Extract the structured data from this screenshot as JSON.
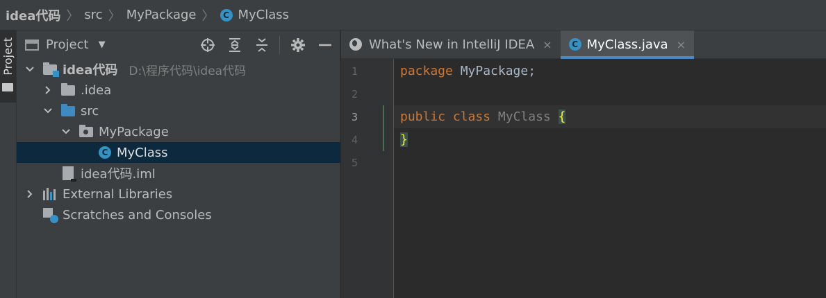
{
  "breadcrumb": {
    "project": "idea代码",
    "src": "src",
    "package": "MyPackage",
    "class": "MyClass",
    "class_icon": "C"
  },
  "toolstrip": {
    "project_label": "Project"
  },
  "project_panel": {
    "title": "Project",
    "tree": {
      "root": {
        "name": "idea代码",
        "path": "D:\\程序代码\\idea代码"
      },
      "idea_folder": ".idea",
      "src_folder": "src",
      "package": "MyPackage",
      "class": "MyClass",
      "class_icon": "C",
      "iml_file": "idea代码.iml",
      "external_libraries": "External Libraries",
      "scratches": "Scratches and Consoles"
    }
  },
  "editor": {
    "tabs": [
      {
        "label": "What's New in IntelliJ IDEA",
        "icon": "globe-icon",
        "close": "×"
      },
      {
        "label": "MyClass.java",
        "icon": "class-icon",
        "icon_letter": "C",
        "close": "×",
        "active": true
      }
    ],
    "line_numbers": [
      "1",
      "2",
      "3",
      "4",
      "5"
    ],
    "code": {
      "line1_kw": "package",
      "line1_rest": " MyPackage;",
      "line3_kw1": "public",
      "line3_kw2": "class",
      "line3_name": "MyClass",
      "line3_brace": "{",
      "line4_brace": "}"
    }
  },
  "colors": {
    "keyword": "#cc7832",
    "identifier": "#a9b7c6",
    "class_name": "#808080",
    "brace": "#ffef28",
    "selection": "#0d293e",
    "accent": "#4a88c7"
  }
}
